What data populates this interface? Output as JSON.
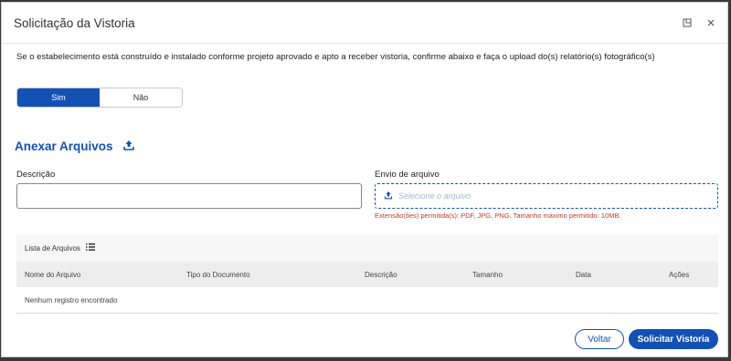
{
  "modal": {
    "title": "Solicitação da Vistoria",
    "instruction": "Se o estabelecimento está construído e instalado conforme projeto aprovado e apto a receber vistoria, confirme abaixo e faça o upload do(s) relatório(s) fotográfico(s)",
    "toggle": {
      "yes": "Sim",
      "no": "Não",
      "selected": "Sim"
    },
    "section_title": "Anexar Arquivos",
    "description_label": "Descrição",
    "description_value": "",
    "upload_label": "Envio de arquivo",
    "upload_placeholder": "Selecione o arquivo",
    "upload_hint": "Extensão(ões) permitida(s): PDF, JPG, PNG. Tamanho máximo permitido: 10MB.",
    "list_title": "Lista de Arquivos",
    "columns": [
      "Nome do Arquivo",
      "Tipo do Documento",
      "Descrição",
      "Tamanho",
      "Data",
      "Ações"
    ],
    "empty_message": "Nenhum registro encontrado",
    "buttons": {
      "back": "Voltar",
      "submit": "Solicitar Vistoria"
    },
    "colors": {
      "primary": "#1351b4",
      "error": "#c0392b"
    },
    "icons": {
      "maximize": "maximize-icon",
      "close": "close-icon",
      "upload": "upload-icon",
      "list": "list-icon"
    }
  }
}
